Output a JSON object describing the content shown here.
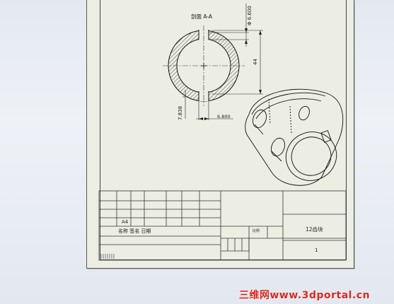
{
  "drawing": {
    "section_label": "剖面 A-A",
    "dimensions": {
      "diameter": "Φ 6.600",
      "height": "44",
      "left_offset": "7.838",
      "bottom_offset": "6.800"
    }
  },
  "title_block": {
    "paper_size": "A4",
    "signature_row": "名称  签名   日期",
    "title": "12齿块",
    "scale_label": "比例",
    "sheet_number": "1"
  },
  "watermark": "三维网www.3dportal.cn"
}
